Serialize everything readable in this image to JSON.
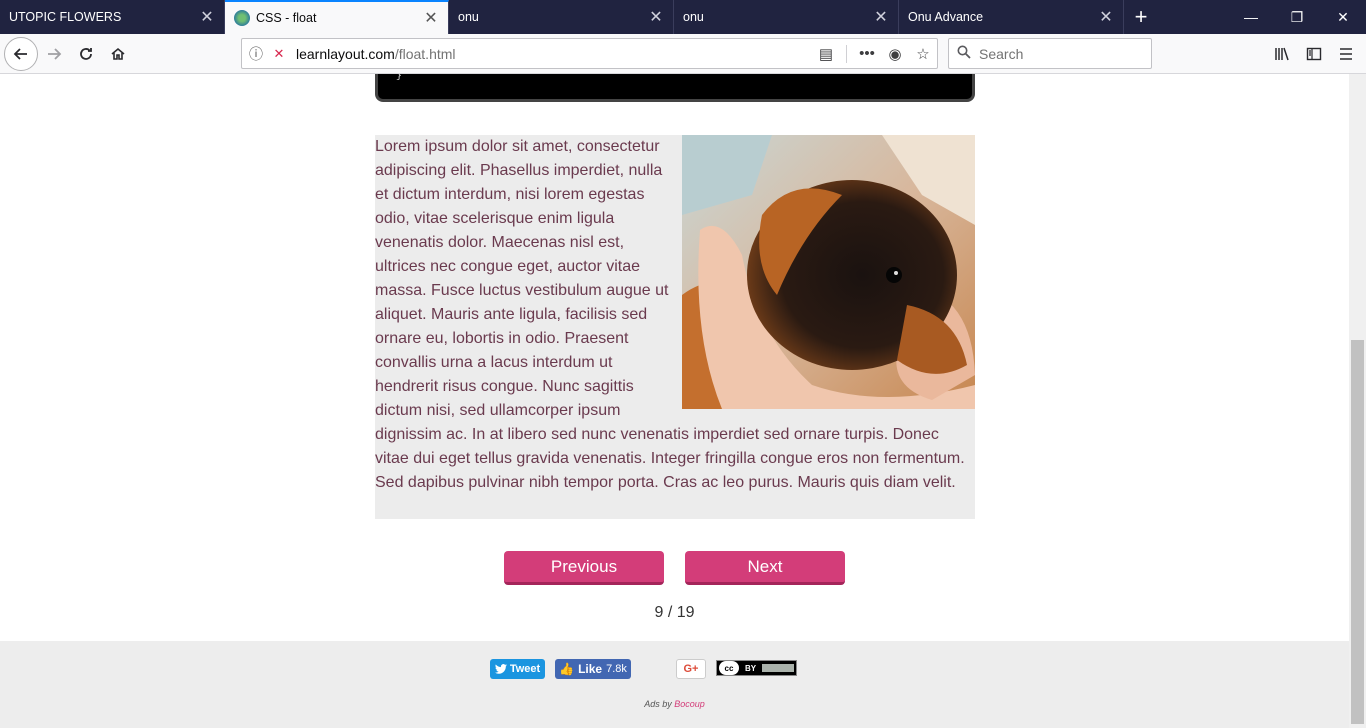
{
  "tabs": [
    {
      "title": "UTOPIC FLOWERS",
      "active": false
    },
    {
      "title": "CSS - float",
      "active": true
    },
    {
      "title": "onu",
      "active": false
    },
    {
      "title": "onu",
      "active": false
    },
    {
      "title": "Onu Advance",
      "active": false
    }
  ],
  "address_bar": {
    "url_domain": "learnlayout.com",
    "url_path": "/float.html"
  },
  "search_bar": {
    "placeholder": "Search"
  },
  "content": {
    "paragraph": "Lorem ipsum dolor sit amet, consectetur adipiscing elit. Phasellus imperdiet, nulla et dictum interdum, nisi lorem egestas odio, vitae scelerisque enim ligula venenatis dolor. Maecenas nisl est, ultrices nec congue eget, auctor vitae massa. Fusce luctus vestibulum augue ut aliquet. Mauris ante ligula, facilisis sed ornare eu, lobortis in odio. Praesent convallis urna a lacus interdum ut hendrerit risus congue. Nunc sagittis dictum nisi, sed ullamcorper ipsum dignissim ac. In at libero sed nunc venenatis imperdiet sed ornare turpis. Donec vitae dui eget tellus gravida venenatis. Integer fringilla congue eros non fermentum. Sed dapibus pulvinar nibh tempor porta. Cras ac leo purus. Mauris quis diam velit.",
    "code_tail": "}"
  },
  "pagination": {
    "previous_label": "Previous",
    "next_label": "Next",
    "page_indicator": "9 / 19"
  },
  "footer": {
    "tweet_label": "Tweet",
    "like_label": "Like",
    "like_count": "7.8k",
    "gplus_label": "G+",
    "cc_label": "BY",
    "ads_prefix": "Ads by ",
    "ads_brand": "Bocoup"
  },
  "colors": {
    "accent": "#d33d79",
    "tab_strip": "#202340",
    "text": "#6a3a4e"
  }
}
